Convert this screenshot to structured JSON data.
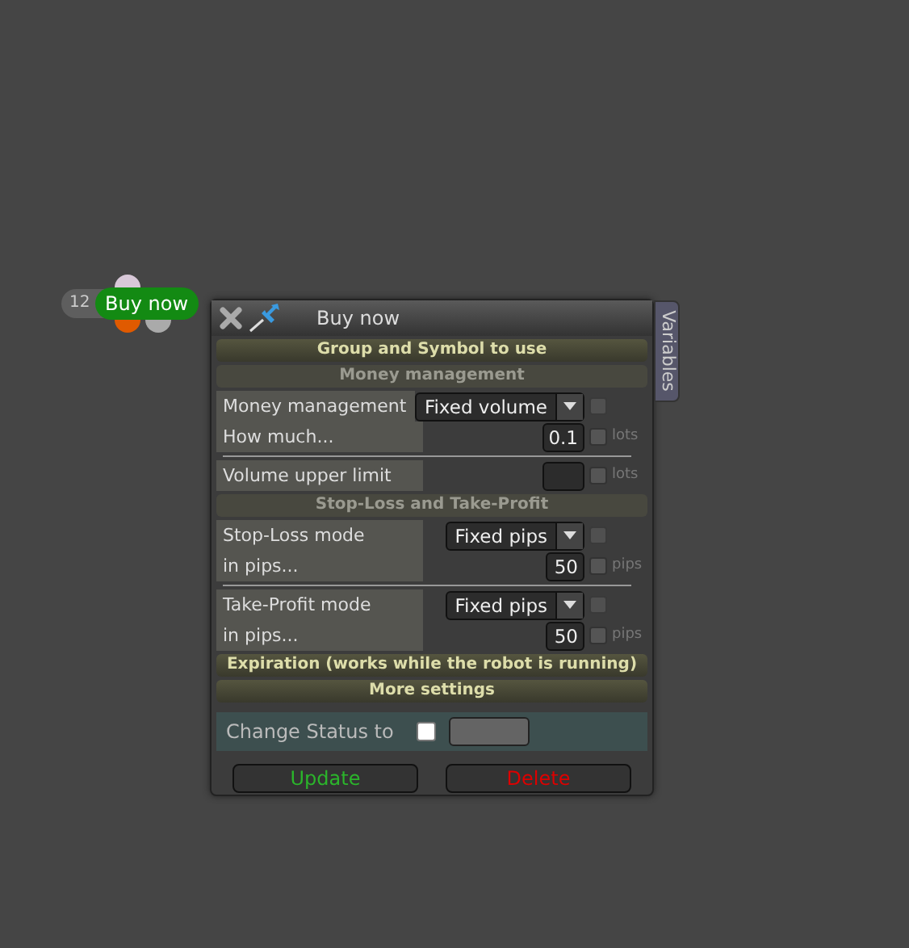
{
  "order_marker": {
    "count": "12",
    "label": "Buy now"
  },
  "panel": {
    "title": "Buy now",
    "side_tab": "Variables"
  },
  "sections": [
    {
      "title": "Group and Symbol to use",
      "expanded": false
    },
    {
      "title": "Money management",
      "expanded": true,
      "groups": [
        [
          {
            "kind": "select",
            "label": "Money management",
            "value": "Fixed volume",
            "checked": false
          },
          {
            "kind": "number",
            "label": "How much...",
            "value": "0.1",
            "unit": "lots",
            "checked": false
          }
        ],
        [
          {
            "kind": "number",
            "label": "Volume upper limit",
            "unit": "lots",
            "checked": false
          }
        ]
      ]
    },
    {
      "title": "Stop-Loss and Take-Profit",
      "expanded": true,
      "groups": [
        [
          {
            "kind": "select",
            "label": "Stop-Loss mode",
            "value": "Fixed pips",
            "checked": false
          },
          {
            "kind": "number",
            "label": "in pips...",
            "value": "50",
            "unit": "pips",
            "checked": false
          }
        ],
        [
          {
            "kind": "select",
            "label": "Take-Profit mode",
            "value": "Fixed pips",
            "checked": false
          },
          {
            "kind": "number",
            "label": "in pips...",
            "value": "50",
            "unit": "pips",
            "checked": false
          }
        ]
      ]
    },
    {
      "title": "Expiration (works while the robot is running)",
      "expanded": false
    },
    {
      "title": "More settings",
      "expanded": false
    }
  ],
  "status": {
    "label": "Change Status to",
    "checked": false
  },
  "buttons": [
    {
      "kind": "confirm",
      "label": "Update"
    },
    {
      "kind": "danger",
      "label": "Delete"
    }
  ]
}
